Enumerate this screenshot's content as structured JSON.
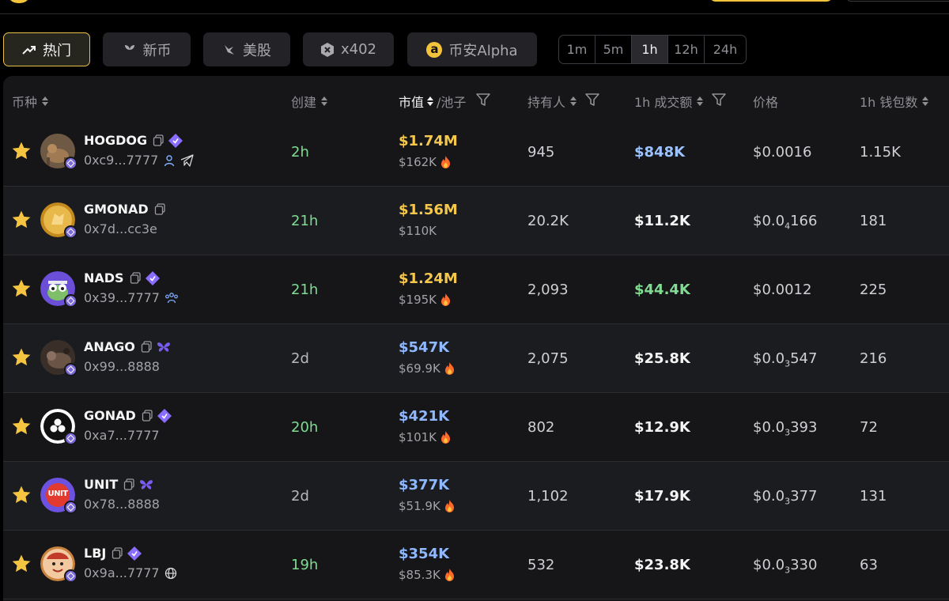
{
  "tabs": [
    {
      "label": "热门",
      "icon": "trending-icon",
      "active": true
    },
    {
      "label": "新币",
      "icon": "sprout-icon",
      "active": false
    },
    {
      "label": "美股",
      "icon": "bull-icon",
      "active": false
    },
    {
      "label": "x402",
      "icon": "x402-hex-icon",
      "active": false
    },
    {
      "label": "币安Alpha",
      "icon": "alpha-icon",
      "active": false
    }
  ],
  "timeframes": [
    {
      "label": "1m",
      "active": false
    },
    {
      "label": "5m",
      "active": false
    },
    {
      "label": "1h",
      "active": true
    },
    {
      "label": "12h",
      "active": false
    },
    {
      "label": "24h",
      "active": false
    }
  ],
  "columns": {
    "token": "币种",
    "created": "创建",
    "mcap": "市值",
    "pool": "/池子",
    "holders": "持有人",
    "volume": "1h 成交额",
    "price": "价格",
    "wallets": "1h 钱包数"
  },
  "alpha_glyph": "a",
  "rows": [
    {
      "name": "HOGDOG",
      "addr": "0xc9...7777",
      "age": "2h",
      "mcap": "$1.74M",
      "pool": "$162K",
      "holders": "945",
      "volume": "$848K",
      "price_main": "$0.0016",
      "price_sub": "",
      "price_tail": "",
      "wallets": "1.15K",
      "age_color": "#7fdc92",
      "mcap_color": "#f5c84c",
      "vol_color": "#9cc3ff",
      "fire": true,
      "verified": true,
      "extra_icons": [
        "user-icon",
        "telegram-icon"
      ],
      "avatar_color": "#8a6a4a",
      "avatar": "dog-photo"
    },
    {
      "name": "GMONAD",
      "addr": "0x7d...cc3e",
      "age": "21h",
      "mcap": "$1.56M",
      "pool": "$110K",
      "holders": "20.2K",
      "volume": "$11.2K",
      "price_main": "$0.0",
      "price_sub": "4",
      "price_tail": "166",
      "wallets": "181",
      "age_color": "#7fdc92",
      "mcap_color": "#f5c84c",
      "vol_color": "#f4f4f4",
      "fire": false,
      "verified": false,
      "extra_icons": [],
      "avatar_color": "#d9a536",
      "avatar": "coin-logo"
    },
    {
      "name": "NADS",
      "addr": "0x39...7777",
      "age": "21h",
      "mcap": "$1.24M",
      "pool": "$195K",
      "holders": "2,093",
      "volume": "$44.4K",
      "price_main": "$0.0012",
      "price_sub": "",
      "price_tail": "",
      "wallets": "225",
      "age_color": "#7fdc92",
      "mcap_color": "#f5c84c",
      "vol_color": "#7fdc92",
      "fire": true,
      "verified": true,
      "extra_icons": [
        "community-icon"
      ],
      "avatar_color": "#6b4fd8",
      "avatar": "pepe-cartoon"
    },
    {
      "name": "ANAGO",
      "addr": "0x99...8888",
      "age": "2d",
      "mcap": "$547K",
      "pool": "$69.9K",
      "holders": "2,075",
      "volume": "$25.8K",
      "price_main": "$0.0",
      "price_sub": "3",
      "price_tail": "547",
      "wallets": "216",
      "age_color": "#b8b8bd",
      "mcap_color": "#8fb8ff",
      "vol_color": "#f4f4f4",
      "fire": true,
      "verified": false,
      "butterfly": true,
      "extra_icons": [],
      "avatar_color": "#4a3a32",
      "avatar": "animal-photo"
    },
    {
      "name": "GONAD",
      "addr": "0xa7...7777",
      "age": "20h",
      "mcap": "$421K",
      "pool": "$101K",
      "holders": "802",
      "volume": "$12.9K",
      "price_main": "$0.0",
      "price_sub": "3",
      "price_tail": "393",
      "wallets": "72",
      "age_color": "#7fdc92",
      "mcap_color": "#8fb8ff",
      "vol_color": "#f4f4f4",
      "fire": true,
      "verified": true,
      "extra_icons": [],
      "avatar_color": "#ffffff",
      "avatar": "black-logo"
    },
    {
      "name": "UNIT",
      "addr": "0x78...8888",
      "age": "2d",
      "mcap": "$377K",
      "pool": "$51.9K",
      "holders": "1,102",
      "volume": "$17.9K",
      "price_main": "$0.0",
      "price_sub": "3",
      "price_tail": "377",
      "wallets": "131",
      "age_color": "#b8b8bd",
      "mcap_color": "#8fb8ff",
      "vol_color": "#f4f4f4",
      "fire": true,
      "verified": false,
      "butterfly": true,
      "extra_icons": [],
      "avatar_color": "#6d52e0",
      "avatar": "unit-logo",
      "avatar_text": "UNIT"
    },
    {
      "name": "LBJ",
      "addr": "0x9a...7777",
      "age": "19h",
      "mcap": "$354K",
      "pool": "$85.3K",
      "holders": "532",
      "volume": "$23.8K",
      "price_main": "$0.0",
      "price_sub": "3",
      "price_tail": "330",
      "wallets": "63",
      "age_color": "#7fdc92",
      "mcap_color": "#8fb8ff",
      "vol_color": "#f4f4f4",
      "fire": true,
      "verified": true,
      "extra_icons": [
        "globe-icon"
      ],
      "avatar_color": "#e0a070",
      "avatar": "cartoon-face"
    }
  ]
}
